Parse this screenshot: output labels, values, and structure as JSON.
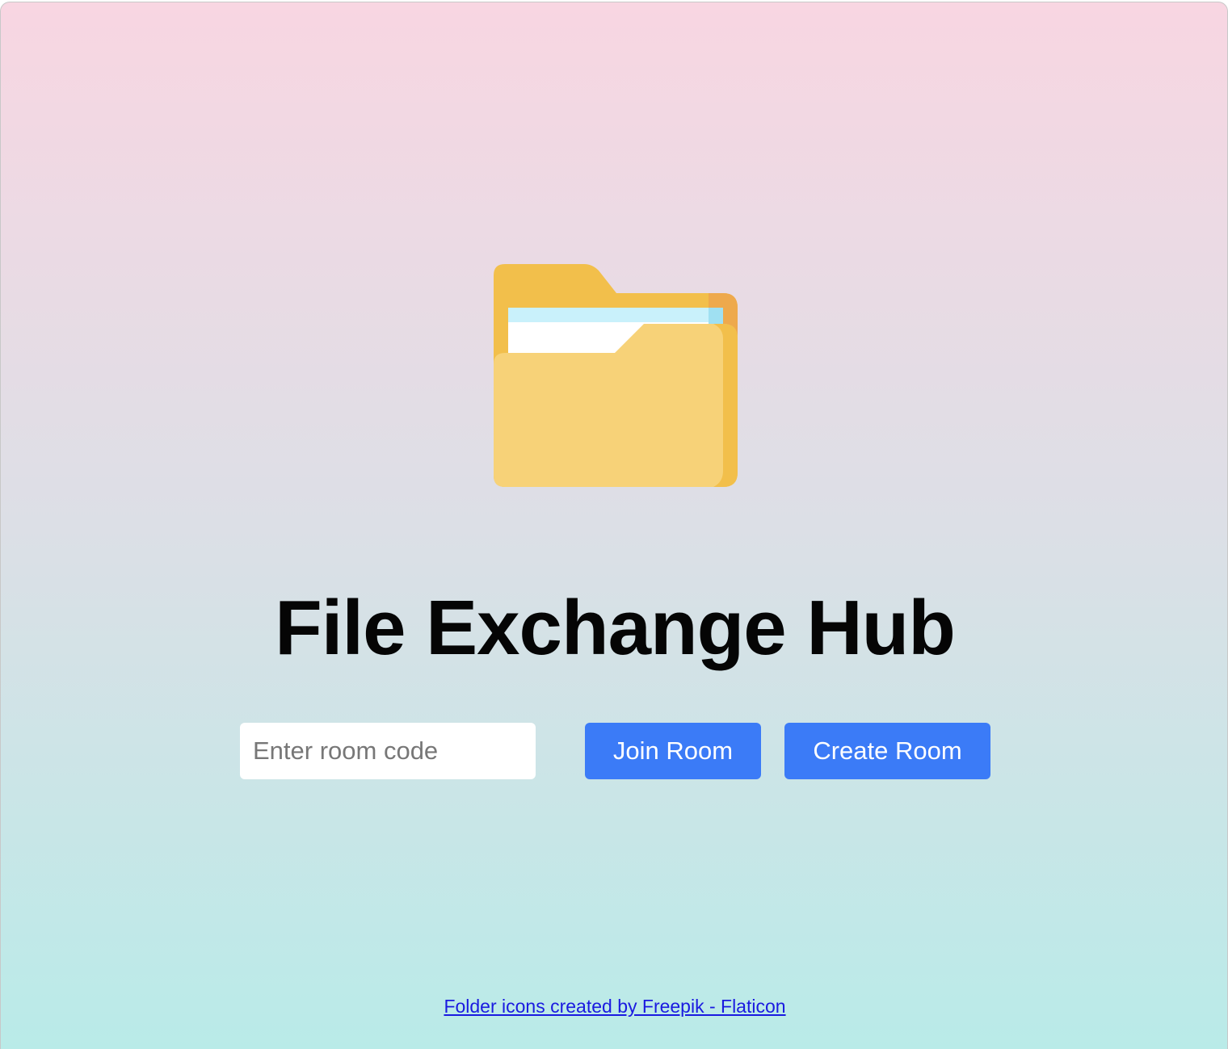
{
  "header": {
    "title": "File Exchange Hub"
  },
  "room": {
    "placeholder": "Enter room code",
    "join_label": "Join Room",
    "create_label": "Create Room"
  },
  "footer": {
    "credit_text": "Folder icons created by Freepik - Flaticon"
  },
  "icons": {
    "hero": "folder-icon"
  },
  "colors": {
    "accent": "#3b7bf7",
    "background_top": "#f8d6e2",
    "background_bottom": "#b9ebe8",
    "link": "#1a1ae0",
    "folder_back": "#f2bf4b",
    "folder_front": "#f7d278",
    "folder_edge": "#eea94c",
    "paper_blue": "#c9f1fb"
  }
}
